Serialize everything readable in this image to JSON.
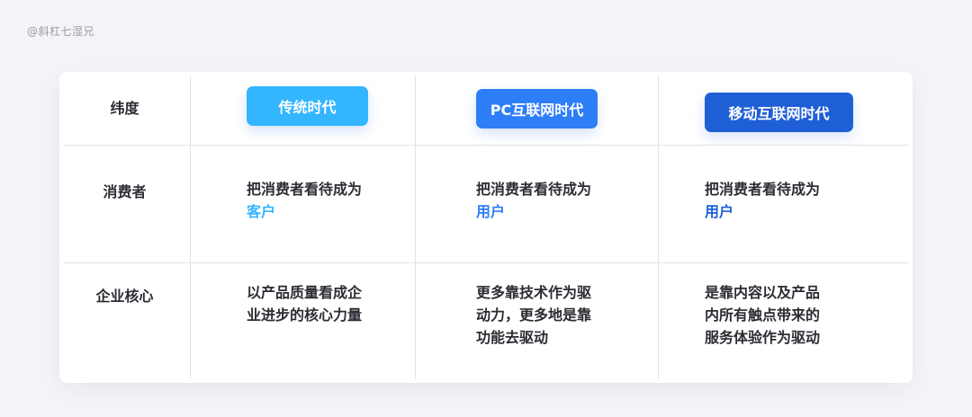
{
  "watermark": "@斜杠七湿兄",
  "table": {
    "header_label": "纬度",
    "eras": [
      {
        "label": "传统时代",
        "color": "#33b5ff"
      },
      {
        "label": "PC互联网时代",
        "color": "#2d7ef7"
      },
      {
        "label": "移动互联网时代",
        "color": "#1f5fd6"
      }
    ],
    "rows": [
      {
        "label": "消费者",
        "cells": [
          {
            "lines": [
              "把消费者看待成为"
            ],
            "highlight": "客户",
            "highlight_color": "#33b5ff"
          },
          {
            "lines": [
              "把消费者看待成为"
            ],
            "highlight": "用户",
            "highlight_color": "#2d7ef7"
          },
          {
            "lines": [
              "把消费者看待成为"
            ],
            "highlight": "用户",
            "highlight_color": "#1f5fd6"
          }
        ]
      },
      {
        "label": "企业核心",
        "cells": [
          {
            "lines": [
              "以产品质量看成企",
              "业进步的核心力量"
            ]
          },
          {
            "lines": [
              "更多靠技术作为驱",
              "动力，更多地是靠",
              "功能去驱动"
            ]
          },
          {
            "lines": [
              "是靠内容以及产品",
              "内所有触点带来的",
              "服务体验作为驱动"
            ]
          }
        ]
      }
    ]
  }
}
